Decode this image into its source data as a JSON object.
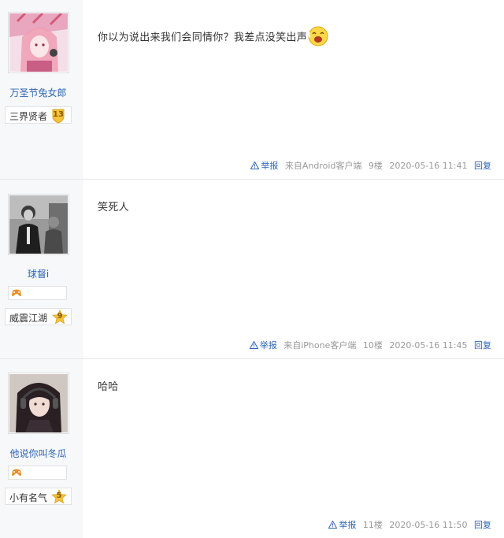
{
  "posts": [
    {
      "username": "万圣节兔女郎",
      "level_name": "三界贤者",
      "level_num": "13",
      "has_fan_badge": false,
      "content": "你以为说出来我们会同情你？我差点没笑出声",
      "emoji": "laughing-face",
      "report_label": "举报",
      "source": "来自Android客户端",
      "floor": "9楼",
      "time": "2020-05-16 11:41",
      "reply_label": "回复"
    },
    {
      "username": "球督i",
      "level_name": "威震江湖",
      "level_num": "9",
      "has_fan_badge": true,
      "content": "笑死人",
      "report_label": "举报",
      "source": "来自iPhone客户端",
      "floor": "10楼",
      "time": "2020-05-16 11:45",
      "reply_label": "回复"
    },
    {
      "username": "他说你叫冬瓜",
      "level_name": "小有名气",
      "level_num": "5",
      "has_fan_badge": true,
      "content": "哈哈",
      "report_label": "举报",
      "source": "",
      "floor": "11楼",
      "time": "2020-05-16 11:50",
      "reply_label": "回复"
    }
  ],
  "colors": {
    "link": "#2d64b3",
    "meta": "#999999",
    "sidebar": "#f7f8fa",
    "level_badge": "#f5c33b"
  }
}
